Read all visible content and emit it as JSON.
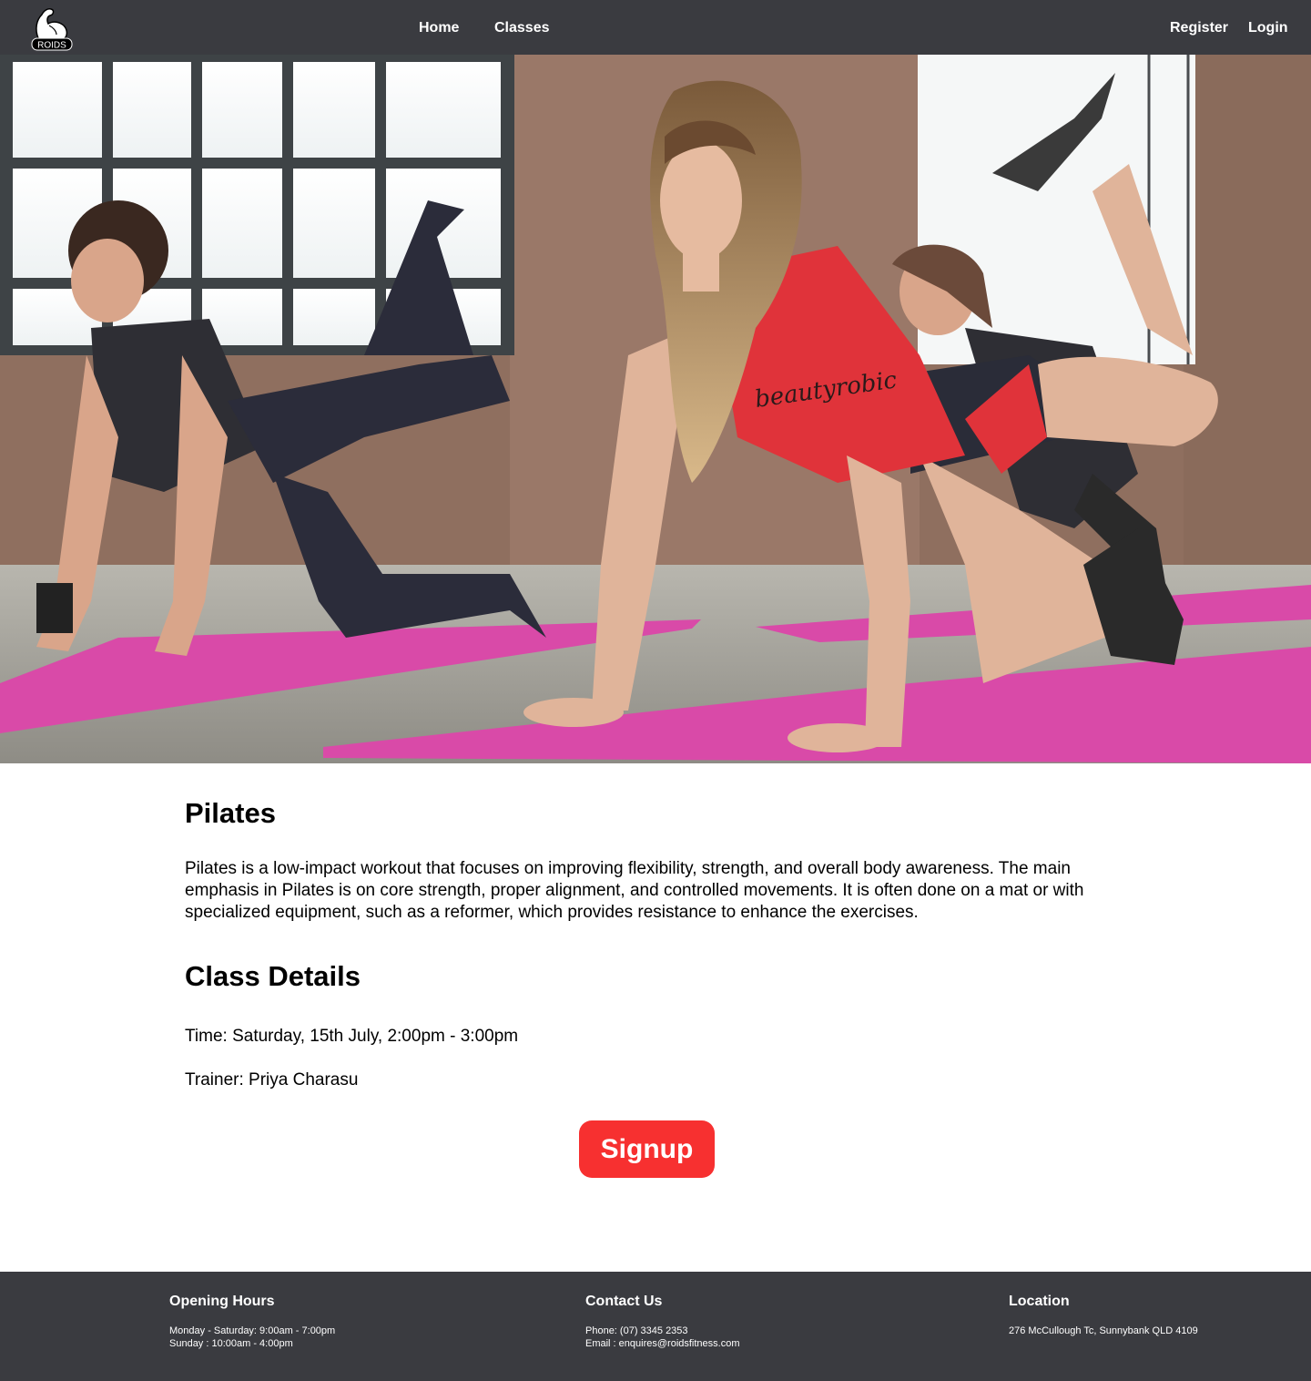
{
  "nav": {
    "logo_text": "ROIDS",
    "links": [
      {
        "label": "Home"
      },
      {
        "label": "Classes"
      }
    ],
    "auth": [
      {
        "label": "Register"
      },
      {
        "label": "Login"
      }
    ]
  },
  "hero": {
    "icon": "fitness-class-photo",
    "shirt_text": "beautyrobic"
  },
  "main": {
    "title": "Pilates",
    "description": "Pilates is a low-impact workout that focuses on improving flexibility, strength, and overall body awareness. The main emphasis in Pilates is on core strength, proper alignment, and controlled movements. It is often done on a mat or with specialized equipment, such as a reformer, which provides resistance to enhance the exercises.",
    "details_title": "Class Details",
    "time": "Time: Saturday, 15th July, 2:00pm - 3:00pm",
    "trainer": "Trainer: Priya Charasu",
    "signup_label": "Signup"
  },
  "footer": {
    "hours": {
      "title": "Opening Hours",
      "lines": [
        "Monday - Saturday: 9:00am - 7:00pm",
        "Sunday : 10:00am - 4:00pm"
      ]
    },
    "contact": {
      "title": "Contact Us",
      "lines": [
        "Phone: (07) 3345 2353",
        "Email : enquires@roidsfitness.com"
      ]
    },
    "location": {
      "title": "Location",
      "lines": [
        "276 McCullough Tc, Sunnybank QLD 4109"
      ]
    }
  },
  "colors": {
    "nav_bg": "#3a3b40",
    "footer_bg": "#3a3b40",
    "signup_bg": "#f73030",
    "mat_pink": "#d94aa8"
  }
}
